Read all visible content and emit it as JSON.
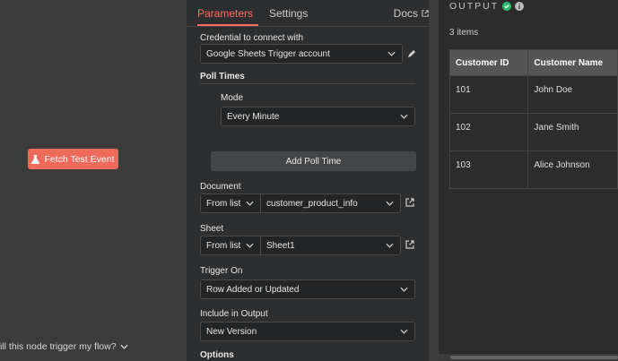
{
  "canvas": {
    "fetch_button": "Fetch Test Event",
    "trigger_question": "ill this node trigger my flow?"
  },
  "tabs": {
    "parameters": "Parameters",
    "settings": "Settings",
    "docs": "Docs"
  },
  "params": {
    "credential_label": "Credential to connect with",
    "credential_value": "Google Sheets Trigger account",
    "poll_times_label": "Poll Times",
    "mode_label": "Mode",
    "mode_value": "Every Minute",
    "add_poll_time": "Add Poll Time",
    "document_label": "Document",
    "document_source": "From list",
    "document_value": "customer_product_info",
    "sheet_label": "Sheet",
    "sheet_source": "From list",
    "sheet_value": "Sheet1",
    "trigger_on_label": "Trigger On",
    "trigger_on_value": "Row Added or Updated",
    "include_label": "Include in Output",
    "include_value": "New Version",
    "options_label": "Options"
  },
  "output": {
    "title": "OUTPUT",
    "count": "3 items",
    "columns": [
      "Customer ID",
      "Customer Name"
    ],
    "rows": [
      [
        "101",
        "John Doe"
      ],
      [
        "102",
        "Jane Smith"
      ],
      [
        "103",
        "Alice Johnson"
      ]
    ]
  },
  "colors": {
    "accent": "#ff6d5a",
    "success": "#2fbf71"
  },
  "icons": [
    "flask-icon",
    "chevron-down-icon",
    "external-link-icon",
    "pencil-icon",
    "check-circle-icon",
    "info-icon"
  ]
}
